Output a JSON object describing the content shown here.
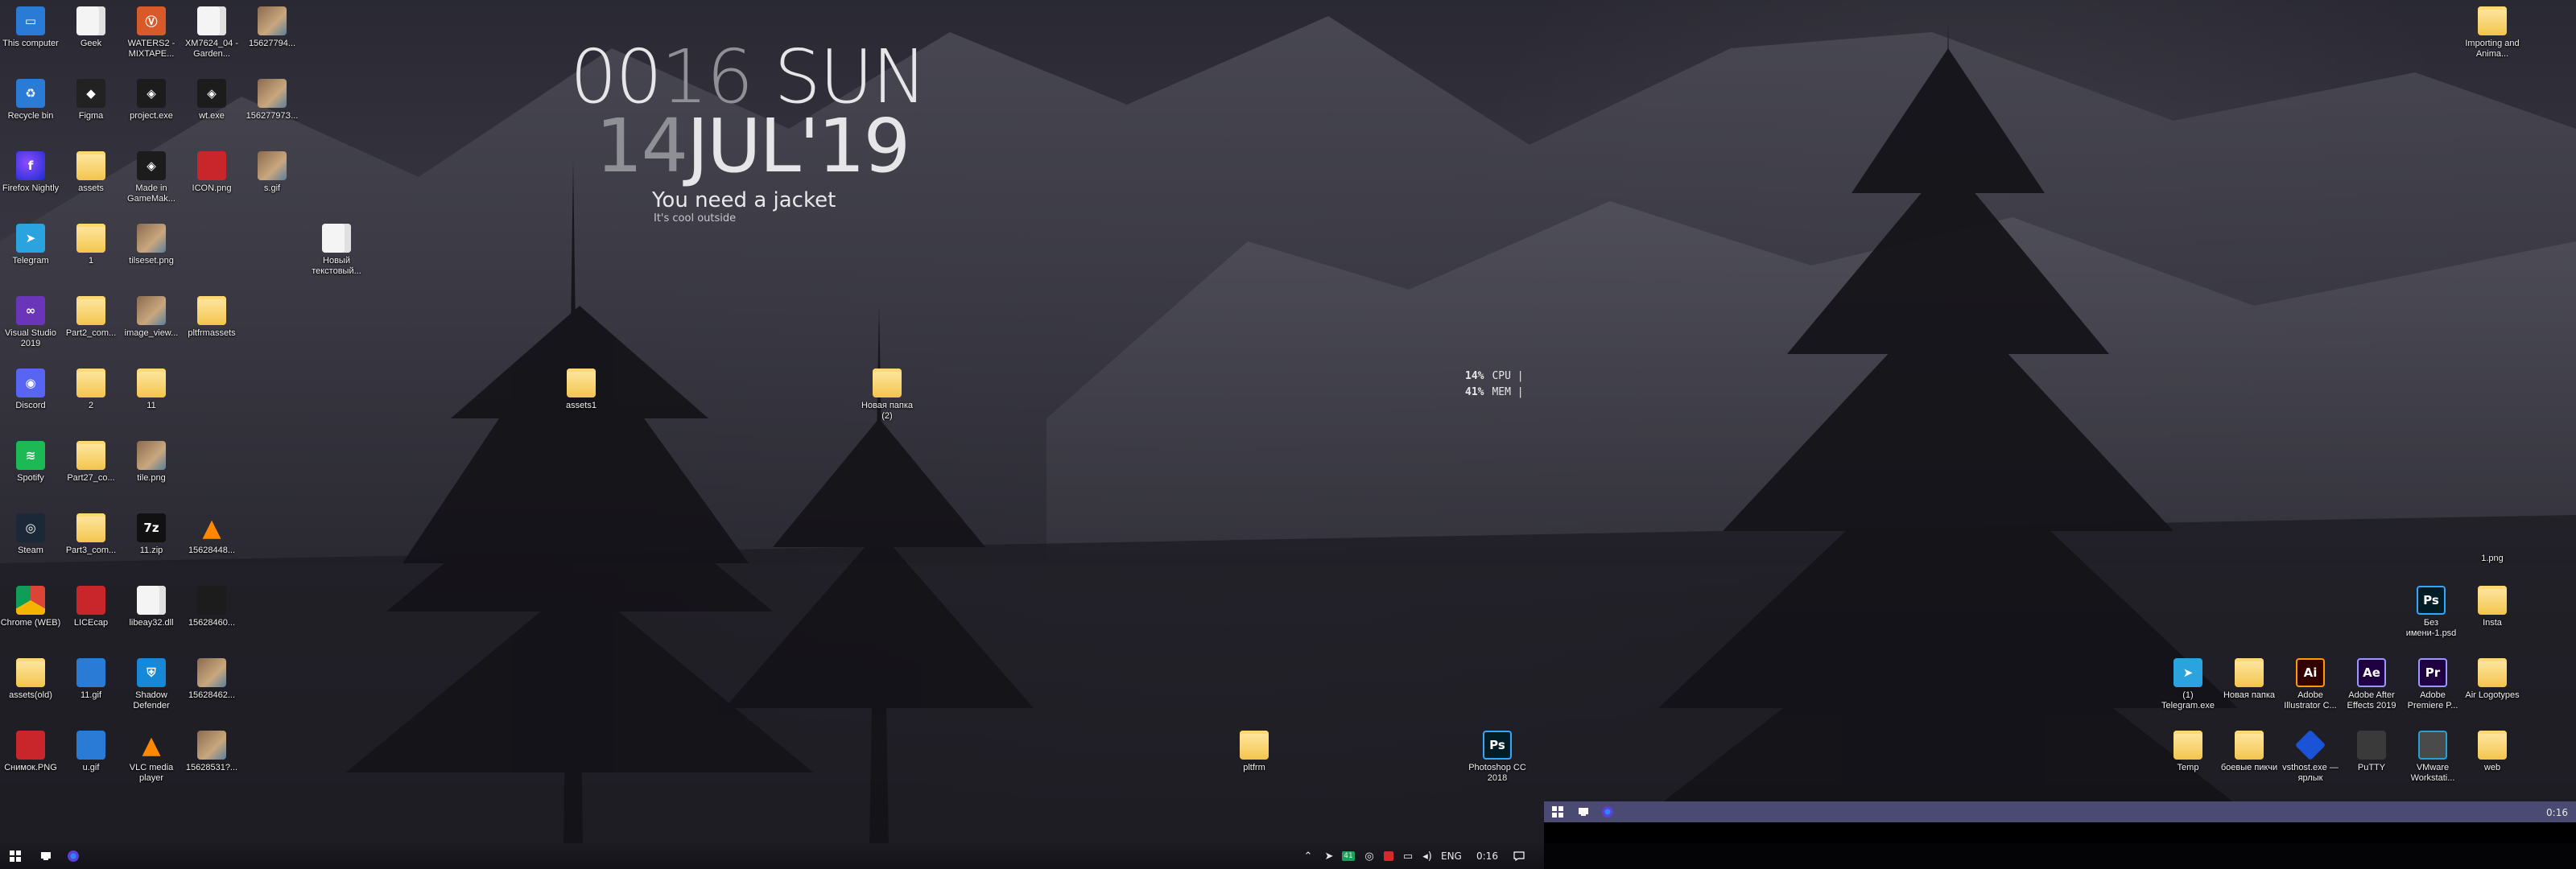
{
  "clock": {
    "time_hours": "00",
    "time_minutes": "16",
    "weekday": "SUN",
    "day": "14",
    "month_year": "JUL'19"
  },
  "weather": {
    "headline": "You need a jacket",
    "subline": "It's cool outside"
  },
  "meter": {
    "cpu_value": "14%",
    "cpu_label": "CPU |",
    "mem_value": "41%",
    "mem_label": "MEM |"
  },
  "desktop_icons": [
    {
      "label": "This computer",
      "icon": "computer-icon"
    },
    {
      "label": "Geek",
      "icon": "document-icon"
    },
    {
      "label": "WATERS2 - MIXTAPE...",
      "icon": "app-icon"
    },
    {
      "label": "XM7624_04 -Garden...",
      "icon": "document-icon"
    },
    {
      "label": "15627794...",
      "icon": "image-icon"
    },
    {
      "label": "Recycle bin",
      "icon": "recycle-bin-icon"
    },
    {
      "label": "Figma",
      "icon": "figma-icon"
    },
    {
      "label": "project.exe",
      "icon": "exe-icon"
    },
    {
      "label": "wt.exe",
      "icon": "exe-icon"
    },
    {
      "label": "15627797З...",
      "icon": "image-icon"
    },
    {
      "label": "Firefox Nightly",
      "icon": "firefox-icon"
    },
    {
      "label": "assets",
      "icon": "folder-icon"
    },
    {
      "label": "Made in GameMak...",
      "icon": "gamemaker-icon"
    },
    {
      "label": "ICON.png",
      "icon": "image-icon"
    },
    {
      "label": "s.gif",
      "icon": "image-icon"
    },
    {
      "label": "Telegram",
      "icon": "telegram-icon"
    },
    {
      "label": "1",
      "icon": "folder-icon"
    },
    {
      "label": "tilseset.png",
      "icon": "image-icon"
    },
    {
      "label": "Новый текстовый...",
      "icon": "document-icon"
    },
    {
      "label": "Visual Studio 2019",
      "icon": "visual-studio-icon"
    },
    {
      "label": "Part2_com...",
      "icon": "folder-icon"
    },
    {
      "label": "image_view...",
      "icon": "image-icon"
    },
    {
      "label": "pltfrmassets",
      "icon": "folder-icon"
    },
    {
      "label": "Discord",
      "icon": "discord-icon"
    },
    {
      "label": "2",
      "icon": "folder-icon"
    },
    {
      "label": "11",
      "icon": "folder-icon"
    },
    {
      "label": "Spotify",
      "icon": "spotify-icon"
    },
    {
      "label": "Part27_co...",
      "icon": "folder-icon"
    },
    {
      "label": "tile.png",
      "icon": "image-icon"
    },
    {
      "label": "Steam",
      "icon": "steam-icon"
    },
    {
      "label": "Part3_com...",
      "icon": "folder-icon"
    },
    {
      "label": "11.zip",
      "icon": "zip-icon"
    },
    {
      "label": "15628448...",
      "icon": "vlc-icon"
    },
    {
      "label": "Chrome (WEB)",
      "icon": "chrome-icon"
    },
    {
      "label": "LICEcap",
      "icon": "licecap-icon"
    },
    {
      "label": "libeay32.dll",
      "icon": "dll-icon"
    },
    {
      "label": "15628460...",
      "icon": "image-icon"
    },
    {
      "label": "assets(old)",
      "icon": "folder-icon"
    },
    {
      "label": "11.gif",
      "icon": "image-icon"
    },
    {
      "label": "Shadow Defender",
      "icon": "shield-icon"
    },
    {
      "label": "15628462...",
      "icon": "image-icon"
    },
    {
      "label": "Снимок.PNG",
      "icon": "image-icon"
    },
    {
      "label": "u.gif",
      "icon": "image-icon"
    },
    {
      "label": "VLC media player",
      "icon": "vlc-icon"
    },
    {
      "label": "15628531?...",
      "icon": "image-icon"
    },
    {
      "label": "assets1",
      "icon": "folder-icon"
    },
    {
      "label": "Новая папка (2)",
      "icon": "folder-icon"
    },
    {
      "label": "pltfrm",
      "icon": "folder-icon"
    },
    {
      "label": "Photoshop CC 2018",
      "icon": "photoshop-icon"
    },
    {
      "label": "Importing and Anima...",
      "icon": "folder-icon"
    },
    {
      "label": "1.png",
      "icon": "image-icon"
    },
    {
      "label": "Без имени-1.psd",
      "icon": "psd-icon"
    },
    {
      "label": "Insta",
      "icon": "folder-icon"
    },
    {
      "label": "(1) Telegram.exe",
      "icon": "telegram-icon"
    },
    {
      "label": "Новая папка",
      "icon": "folder-icon"
    },
    {
      "label": "Adobe Illustrator C...",
      "icon": "illustrator-icon"
    },
    {
      "label": "Adobe After Effects 2019",
      "icon": "after-effects-icon"
    },
    {
      "label": "Adobe Premiere P...",
      "icon": "premiere-icon"
    },
    {
      "label": "Air Logotypes",
      "icon": "folder-icon"
    },
    {
      "label": "Temp",
      "icon": "folder-icon"
    },
    {
      "label": "боевые пикчи",
      "icon": "folder-icon"
    },
    {
      "label": "vsthost.exe — ярлык",
      "icon": "vsthost-icon"
    },
    {
      "label": "PuTTY",
      "icon": "putty-icon"
    },
    {
      "label": "VMware Workstati...",
      "icon": "vmware-icon"
    },
    {
      "label": "web",
      "icon": "folder-icon"
    }
  ],
  "icon_text": {
    "ps": "Ps",
    "ai": "Ai",
    "ae": "Ae",
    "pr": "Pr",
    "zip": "7z",
    "firefox": "f",
    "telegram": "➤",
    "discord": "◉",
    "spotify": "≋",
    "steam": "◎",
    "figma": "◆",
    "vlc": "▲",
    "shield": "⛨",
    "gm": "◈",
    "water": "Ⓥ",
    "vs": "∞",
    "comp": "▭",
    "bin": "♻",
    "psd": "Ps"
  },
  "taskbar": {
    "lang": "ENG",
    "time": "0:16",
    "secondary_time": "0:16",
    "tray_badge": "41"
  }
}
